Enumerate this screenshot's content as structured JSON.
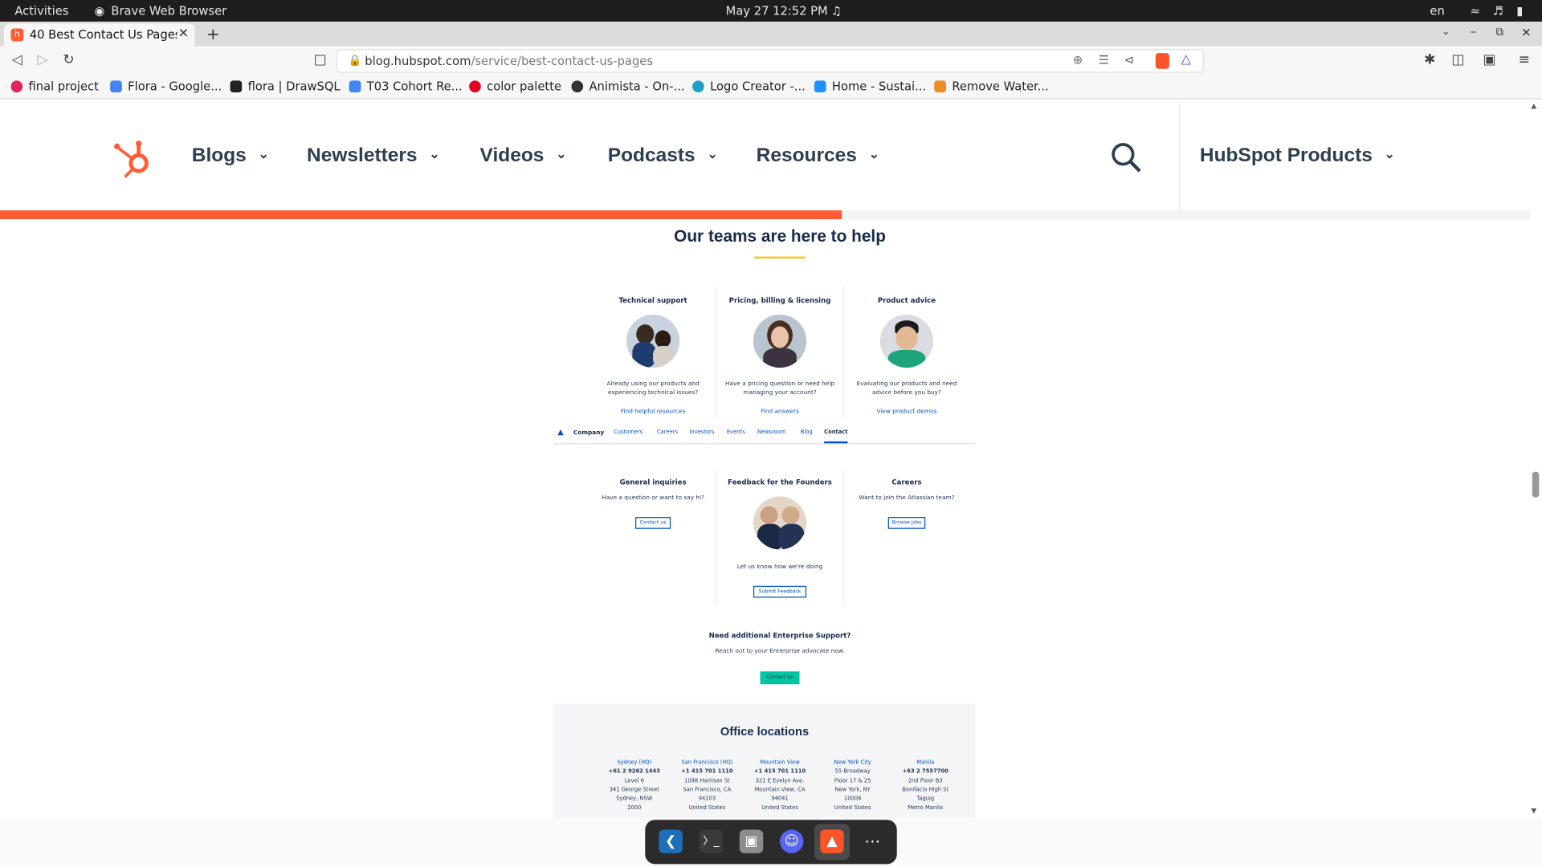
{
  "system_bar": {
    "activities": "Activities",
    "app_name": "Brave Web Browser",
    "datetime": "May 27  12:52 PM",
    "language": "en"
  },
  "browser": {
    "tab_title": "40 Best Contact Us Pages",
    "url_domain": "blog.hubspot.com",
    "url_path": "/service/best-contact-us-pages",
    "bookmarks": [
      {
        "label": "final project",
        "color": "#e0245e"
      },
      {
        "label": "Flora - Google...",
        "color": "#4285f4"
      },
      {
        "label": "flora | DrawSQL",
        "color": "#222222"
      },
      {
        "label": "T03 Cohort Re...",
        "color": "#4285f4"
      },
      {
        "label": "color palette",
        "color": "#e60023"
      },
      {
        "label": "Animista - On-...",
        "color": "#333333"
      },
      {
        "label": "Logo Creator -...",
        "color": "#21a0c8"
      },
      {
        "label": "Home - Sustai...",
        "color": "#1e90ff"
      },
      {
        "label": "Remove Water...",
        "color": "#f08a24"
      }
    ]
  },
  "site_nav": {
    "items": [
      "Blogs",
      "Newsletters",
      "Videos",
      "Podcasts",
      "Resources"
    ],
    "products": "HubSpot Products",
    "brand_color": "#ff5c35",
    "progress_fraction": 0.55
  },
  "article": {
    "heading": "Our teams are here to help",
    "support_cards": [
      {
        "title": "Technical support",
        "desc1": "Already using our products and",
        "desc2": "experiencing technical issues?",
        "link": "Find helpful resources"
      },
      {
        "title": "Pricing, billing & licensing",
        "desc1": "Have a pricing question or need help",
        "desc2": "managing your account?",
        "link": "Find answers"
      },
      {
        "title": "Product advice",
        "desc1": "Evaluating our products and need",
        "desc2": "advice before you buy?",
        "link": "View product demos"
      }
    ],
    "company_nav": {
      "brand": "Company",
      "links": [
        "Customers",
        "Careers",
        "Investors",
        "Events",
        "Newsroom",
        "Blog",
        "Contact"
      ]
    },
    "contact_cards": [
      {
        "title": "General inquiries",
        "desc": "Have a question or want to say hi?",
        "button": "Contact us"
      },
      {
        "title": "Feedback for the Founders",
        "desc": "Let us know how we're doing",
        "button": "Submit Feedback"
      },
      {
        "title": "Careers",
        "desc": "Want to join the Atlassian team?",
        "button": "Browse jobs"
      }
    ],
    "enterprise": {
      "title": "Need additional Enterprise Support?",
      "desc": "Reach out to your Enterprise advocate now.",
      "button": "Contact Us"
    },
    "offices_title": "Office locations",
    "offices": [
      {
        "city": "Sydney (HQ)",
        "phone": "+61 2 9262 1443",
        "lines": [
          "Level 6",
          "341 George Street",
          "Sydney, NSW",
          "2000"
        ]
      },
      {
        "city": "San Francisco (HQ)",
        "phone": "+1 415 701 1110",
        "lines": [
          "1098 Harrison St",
          "San Francisco, CA",
          "94103",
          "United States"
        ]
      },
      {
        "city": "Mountain View",
        "phone": "+1 415 701 1110",
        "lines": [
          "321 E Evelyn Ave.",
          "Mountain View, CA",
          "94041",
          "United States"
        ]
      },
      {
        "city": "New York City",
        "phone": "",
        "lines": [
          "55 Broadway",
          "Floor 17 & 25",
          "New York, NY",
          "10006",
          "United States"
        ]
      },
      {
        "city": "Manila",
        "phone": "+63 2 7557700",
        "lines": [
          "2nd Floor B3",
          "Bonifacio High St",
          "Taguig",
          "Metro Manila"
        ]
      }
    ]
  },
  "dock": {
    "apps": [
      "vscode-icon",
      "terminal-icon",
      "files-icon",
      "discord-icon",
      "brave-icon",
      "app-grid-icon"
    ]
  }
}
